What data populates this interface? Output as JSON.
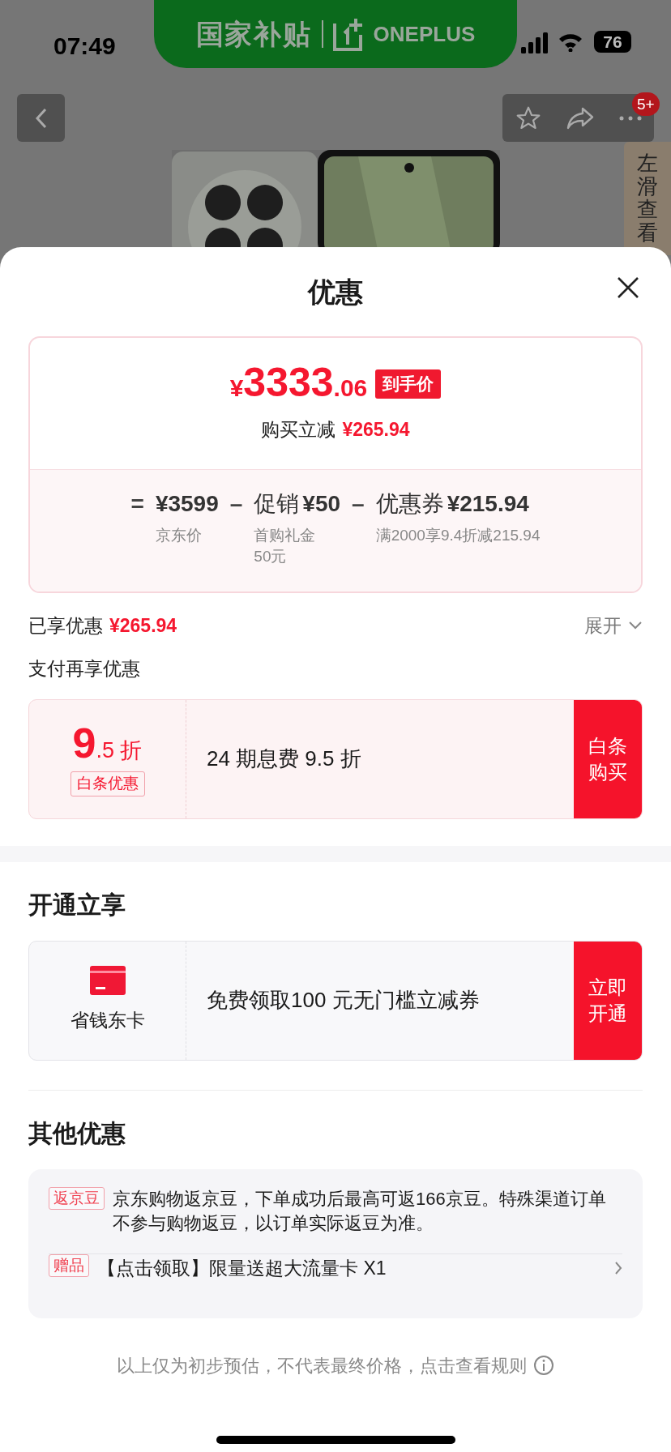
{
  "status_bar": {
    "time": "07:49",
    "battery": "76"
  },
  "banner": {
    "title": "国家补贴",
    "brand": "ONEPLUS"
  },
  "nav": {
    "badge": "5+"
  },
  "side_tab": {
    "label": "左滑查看"
  },
  "sheet": {
    "title": "优惠"
  },
  "price": {
    "currency": "¥",
    "integer": "3333",
    "decimal": ".06",
    "tag": "到手价",
    "saving_label": "购买立减",
    "saving_value": "¥265.94"
  },
  "breakdown": [
    {
      "operator": "=",
      "value": "¥3599",
      "note": [
        "京东价"
      ]
    },
    {
      "operator": "–",
      "label": "促销",
      "value": "¥50",
      "note": [
        "首购礼金",
        "50元"
      ]
    },
    {
      "operator": "–",
      "label": "优惠券",
      "value": "¥215.94",
      "note": [
        "满2000享9.4折减215.94"
      ]
    }
  ],
  "enjoyed": {
    "label": "已享优惠",
    "value": "¥265.94",
    "toggle": "展开",
    "expanded": false
  },
  "pay_section": {
    "title": "支付再享优惠",
    "offer": {
      "big": "9",
      "small": ".5 折",
      "tag": "白条优惠",
      "desc": "24 期息费 9.5 折",
      "button": "白条购买"
    }
  },
  "open_section": {
    "title": "开通立享",
    "card": {
      "name": "省钱东卡",
      "desc": "免费领取100 元无门槛立减券",
      "button": "立即开通"
    }
  },
  "other_section": {
    "title": "其他优惠",
    "items": [
      {
        "kind": "info",
        "tag": "返京豆",
        "text": "京东购物返京豆，下单成功后最高可返166京豆。特殊渠道订单不参与购物返豆，以订单实际返豆为准。"
      },
      {
        "kind": "link",
        "tag": "赠品",
        "text": "【点击领取】限量送超大流量卡 X1"
      }
    ]
  },
  "footer": {
    "text": "以上仅为初步预估，不代表最终价格，点击查看规则"
  }
}
